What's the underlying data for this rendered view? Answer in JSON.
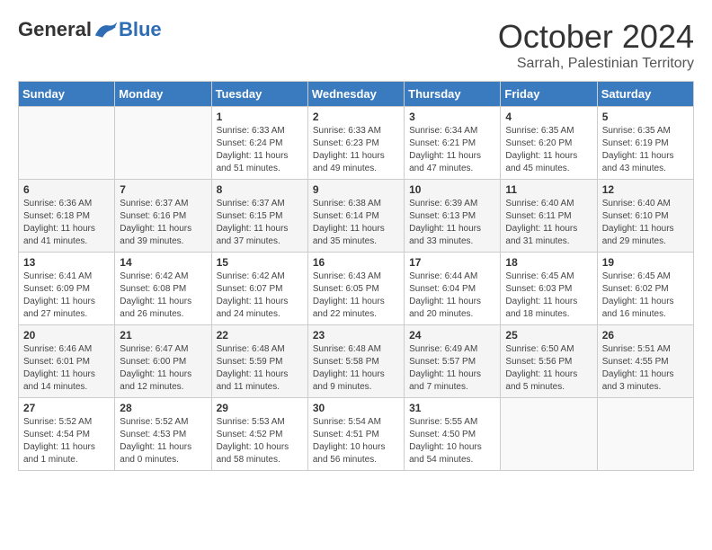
{
  "logo": {
    "general": "General",
    "blue": "Blue"
  },
  "title": "October 2024",
  "subtitle": "Sarrah, Palestinian Territory",
  "days": [
    "Sunday",
    "Monday",
    "Tuesday",
    "Wednesday",
    "Thursday",
    "Friday",
    "Saturday"
  ],
  "weeks": [
    [
      {
        "day": "",
        "info": ""
      },
      {
        "day": "",
        "info": ""
      },
      {
        "day": "1",
        "info": "Sunrise: 6:33 AM\nSunset: 6:24 PM\nDaylight: 11 hours and 51 minutes."
      },
      {
        "day": "2",
        "info": "Sunrise: 6:33 AM\nSunset: 6:23 PM\nDaylight: 11 hours and 49 minutes."
      },
      {
        "day": "3",
        "info": "Sunrise: 6:34 AM\nSunset: 6:21 PM\nDaylight: 11 hours and 47 minutes."
      },
      {
        "day": "4",
        "info": "Sunrise: 6:35 AM\nSunset: 6:20 PM\nDaylight: 11 hours and 45 minutes."
      },
      {
        "day": "5",
        "info": "Sunrise: 6:35 AM\nSunset: 6:19 PM\nDaylight: 11 hours and 43 minutes."
      }
    ],
    [
      {
        "day": "6",
        "info": "Sunrise: 6:36 AM\nSunset: 6:18 PM\nDaylight: 11 hours and 41 minutes."
      },
      {
        "day": "7",
        "info": "Sunrise: 6:37 AM\nSunset: 6:16 PM\nDaylight: 11 hours and 39 minutes."
      },
      {
        "day": "8",
        "info": "Sunrise: 6:37 AM\nSunset: 6:15 PM\nDaylight: 11 hours and 37 minutes."
      },
      {
        "day": "9",
        "info": "Sunrise: 6:38 AM\nSunset: 6:14 PM\nDaylight: 11 hours and 35 minutes."
      },
      {
        "day": "10",
        "info": "Sunrise: 6:39 AM\nSunset: 6:13 PM\nDaylight: 11 hours and 33 minutes."
      },
      {
        "day": "11",
        "info": "Sunrise: 6:40 AM\nSunset: 6:11 PM\nDaylight: 11 hours and 31 minutes."
      },
      {
        "day": "12",
        "info": "Sunrise: 6:40 AM\nSunset: 6:10 PM\nDaylight: 11 hours and 29 minutes."
      }
    ],
    [
      {
        "day": "13",
        "info": "Sunrise: 6:41 AM\nSunset: 6:09 PM\nDaylight: 11 hours and 27 minutes."
      },
      {
        "day": "14",
        "info": "Sunrise: 6:42 AM\nSunset: 6:08 PM\nDaylight: 11 hours and 26 minutes."
      },
      {
        "day": "15",
        "info": "Sunrise: 6:42 AM\nSunset: 6:07 PM\nDaylight: 11 hours and 24 minutes."
      },
      {
        "day": "16",
        "info": "Sunrise: 6:43 AM\nSunset: 6:05 PM\nDaylight: 11 hours and 22 minutes."
      },
      {
        "day": "17",
        "info": "Sunrise: 6:44 AM\nSunset: 6:04 PM\nDaylight: 11 hours and 20 minutes."
      },
      {
        "day": "18",
        "info": "Sunrise: 6:45 AM\nSunset: 6:03 PM\nDaylight: 11 hours and 18 minutes."
      },
      {
        "day": "19",
        "info": "Sunrise: 6:45 AM\nSunset: 6:02 PM\nDaylight: 11 hours and 16 minutes."
      }
    ],
    [
      {
        "day": "20",
        "info": "Sunrise: 6:46 AM\nSunset: 6:01 PM\nDaylight: 11 hours and 14 minutes."
      },
      {
        "day": "21",
        "info": "Sunrise: 6:47 AM\nSunset: 6:00 PM\nDaylight: 11 hours and 12 minutes."
      },
      {
        "day": "22",
        "info": "Sunrise: 6:48 AM\nSunset: 5:59 PM\nDaylight: 11 hours and 11 minutes."
      },
      {
        "day": "23",
        "info": "Sunrise: 6:48 AM\nSunset: 5:58 PM\nDaylight: 11 hours and 9 minutes."
      },
      {
        "day": "24",
        "info": "Sunrise: 6:49 AM\nSunset: 5:57 PM\nDaylight: 11 hours and 7 minutes."
      },
      {
        "day": "25",
        "info": "Sunrise: 6:50 AM\nSunset: 5:56 PM\nDaylight: 11 hours and 5 minutes."
      },
      {
        "day": "26",
        "info": "Sunrise: 5:51 AM\nSunset: 4:55 PM\nDaylight: 11 hours and 3 minutes."
      }
    ],
    [
      {
        "day": "27",
        "info": "Sunrise: 5:52 AM\nSunset: 4:54 PM\nDaylight: 11 hours and 1 minute."
      },
      {
        "day": "28",
        "info": "Sunrise: 5:52 AM\nSunset: 4:53 PM\nDaylight: 11 hours and 0 minutes."
      },
      {
        "day": "29",
        "info": "Sunrise: 5:53 AM\nSunset: 4:52 PM\nDaylight: 10 hours and 58 minutes."
      },
      {
        "day": "30",
        "info": "Sunrise: 5:54 AM\nSunset: 4:51 PM\nDaylight: 10 hours and 56 minutes."
      },
      {
        "day": "31",
        "info": "Sunrise: 5:55 AM\nSunset: 4:50 PM\nDaylight: 10 hours and 54 minutes."
      },
      {
        "day": "",
        "info": ""
      },
      {
        "day": "",
        "info": ""
      }
    ]
  ]
}
